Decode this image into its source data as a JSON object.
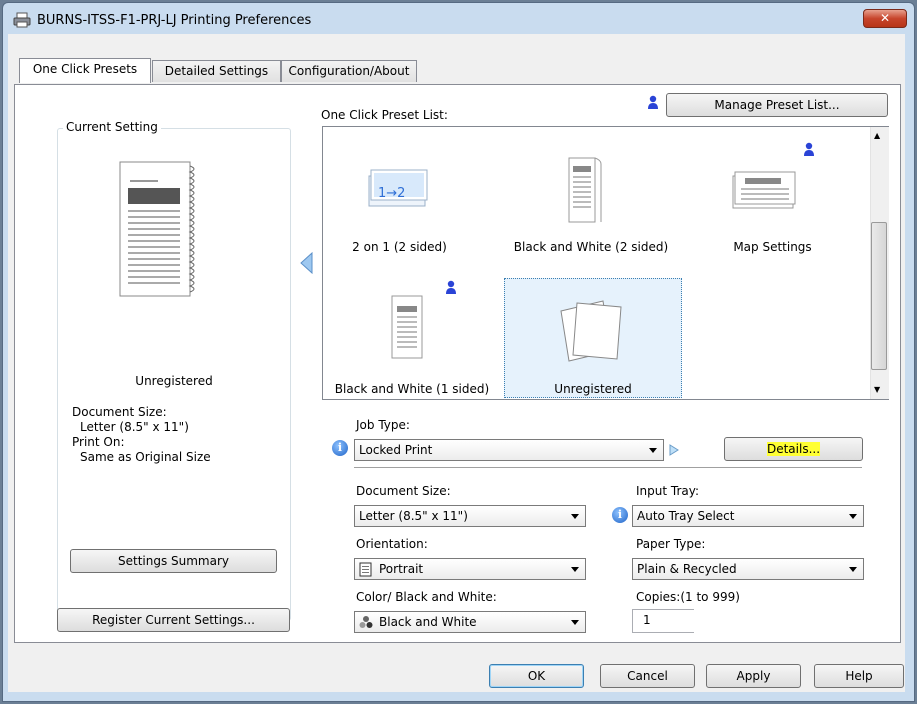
{
  "window": {
    "title": "BURNS-ITSS-F1-PRJ-LJ Printing Preferences",
    "close_label": "✕"
  },
  "tabs": [
    {
      "label": "One Click Presets"
    },
    {
      "label": "Detailed Settings"
    },
    {
      "label": "Configuration/About"
    }
  ],
  "current_setting": {
    "group_label": "Current Setting",
    "preview_label": "Unregistered",
    "document_size_label": "Document Size:",
    "document_size_value": "Letter (8.5\" x 11\")",
    "print_on_label": "Print On:",
    "print_on_value": "Same as Original Size",
    "settings_summary_button": "Settings Summary",
    "register_button": "Register Current Settings..."
  },
  "preset_list": {
    "label": "One Click Preset List:",
    "manage_button": "Manage Preset List...",
    "items": [
      {
        "label": "2 on 1 (2 sided)",
        "glyph": "1→2"
      },
      {
        "label": "Black and White (2 sided)"
      },
      {
        "label": "Map Settings"
      },
      {
        "label": "Black and White (1 sided)"
      },
      {
        "label": "Unregistered"
      }
    ]
  },
  "job_type": {
    "label": "Job Type:",
    "value": "Locked Print",
    "details_button": "Details..."
  },
  "document_size": {
    "label": "Document Size:",
    "value": "Letter (8.5\" x 11\")"
  },
  "input_tray": {
    "label": "Input Tray:",
    "value": "Auto Tray Select"
  },
  "orientation": {
    "label": "Orientation:",
    "value": "Portrait"
  },
  "paper_type": {
    "label": "Paper Type:",
    "value": "Plain & Recycled"
  },
  "color": {
    "label": "Color/ Black and White:",
    "value": "Black and White"
  },
  "copies": {
    "label": "Copies:(1 to 999)",
    "value": "1"
  },
  "footer": {
    "ok": "OK",
    "cancel": "Cancel",
    "apply": "Apply",
    "help": "Help"
  }
}
